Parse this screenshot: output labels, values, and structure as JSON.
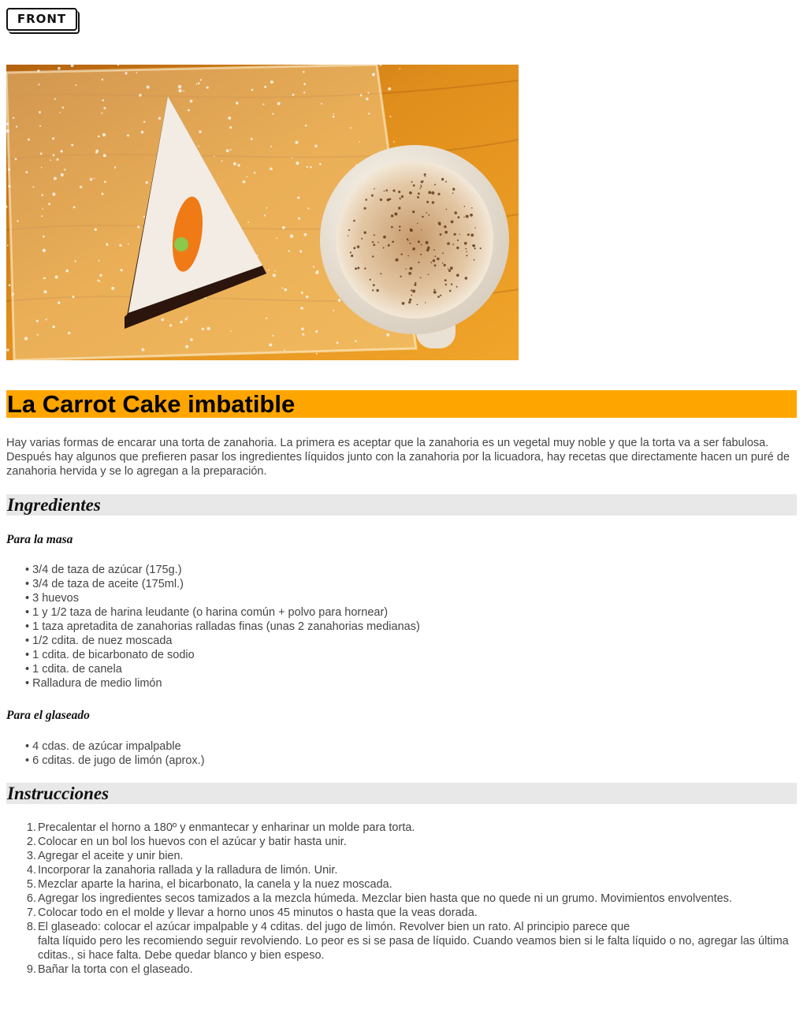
{
  "logo": {
    "text": "FRONT"
  },
  "hero_image": {
    "alt": "carrot cake slice and cappuccino"
  },
  "title": "La Carrot Cake imbatible",
  "intro": "Hay varias formas de encarar una torta de zanahoria. La primera es aceptar que la zanahoria es un vegetal muy noble y que la torta va a ser fabulosa. Después hay algunos que prefieren pasar los ingredientes líquidos junto con la zanahoria por la licuadora, hay recetas que directamente hacen un puré de zanahoria hervida y se lo agregan a la preparación.",
  "ingredients": {
    "heading": "Ingredientes",
    "masa": {
      "heading": "Para la masa",
      "items": [
        "3/4 de taza de azúcar (175g.)",
        "3/4 de taza de aceite (175ml.)",
        "3 huevos",
        "1 y 1/2 taza de harina leudante (o harina común + polvo para hornear)",
        "1 taza apretadita de zanahorias ralladas finas (unas 2 zanahorias medianas)",
        "1/2 cdita. de nuez moscada",
        "1 cdita. de bicarbonato de sodio",
        "1 cdita. de canela",
        "Ralladura de medio limón"
      ]
    },
    "glaseado": {
      "heading": "Para el glaseado",
      "items": [
        "4 cdas. de azúcar impalpable",
        "6 cditas. de jugo de limón (aprox.)"
      ]
    }
  },
  "instructions": {
    "heading": "Instrucciones",
    "steps": [
      {
        "num": "1.",
        "lines": [
          "Precalentar el horno a 180º y enmantecar y enharinar un molde para torta."
        ]
      },
      {
        "num": "2.",
        "lines": [
          "Colocar en un bol los huevos con el azúcar y batir hasta unir."
        ]
      },
      {
        "num": "3.",
        "lines": [
          "Agregar el aceite y unir bien."
        ]
      },
      {
        "num": "4.",
        "lines": [
          "Incorporar la zanahoria rallada y la ralladura de limón. Unir."
        ]
      },
      {
        "num": "5.",
        "lines": [
          "Mezclar aparte la harina, el bicarbonato, la canela y la nuez moscada."
        ]
      },
      {
        "num": "6.",
        "lines": [
          "Agregar los ingredientes secos tamizados a la mezcla húmeda. Mezclar bien hasta que no quede ni un grumo. Movimientos envolventes."
        ]
      },
      {
        "num": "7.",
        "lines": [
          "Colocar todo en el molde y llevar a horno unos 45 minutos o hasta que la veas dorada."
        ]
      },
      {
        "num": "8.",
        "lines": [
          "El glaseado: colocar el azúcar impalpable y 4 cditas. del jugo de limón. Revolver bien un rato. Al principio parece que",
          "falta líquido pero les recomiendo seguir revolviendo. Lo peor es si se pasa de líquido. Cuando veamos bien si le falta líquido o no, agregar las última cditas., si hace falta. Debe quedar blanco y bien espeso."
        ]
      },
      {
        "num": "9.",
        "lines": [
          "Bañar la torta con el glaseado."
        ]
      }
    ]
  },
  "colors": {
    "title_bg": "#ffa500",
    "section_bg": "#e8e8e8",
    "text": "#444444"
  }
}
